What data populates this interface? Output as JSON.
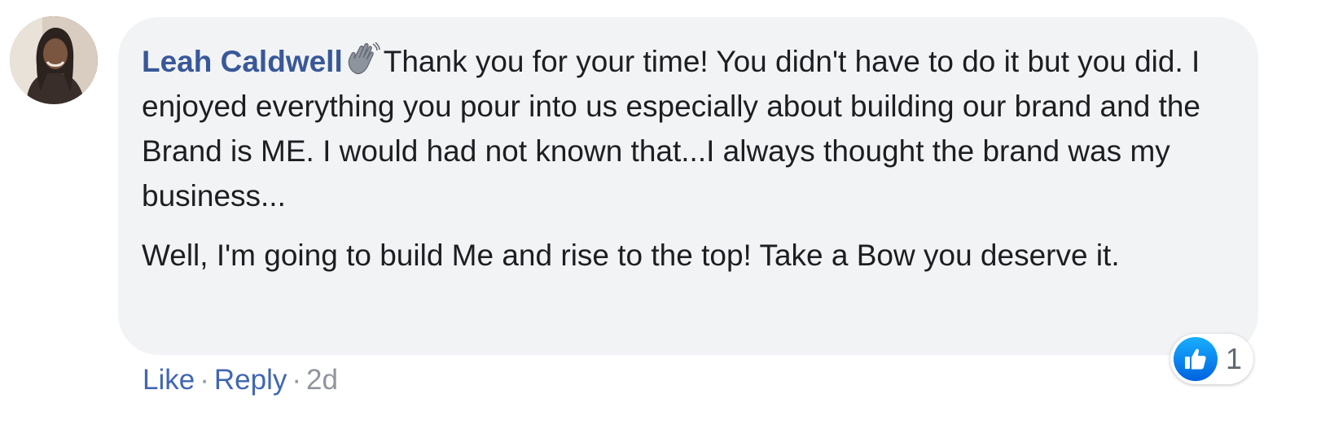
{
  "comment": {
    "author": "Leah Caldwell",
    "author_icon": "waving-hand-icon",
    "paragraph1": "Thank you for your time! You didn't have to do it but you did. I enjoyed everything you pour into us especially about building our brand and the Brand is ME. I would had not known that...I always thought the brand was my business...",
    "paragraph2": "Well, I'm going to build Me and rise to the top! Take a Bow you deserve it.",
    "actions": {
      "like_label": "Like",
      "reply_label": "Reply",
      "separator": "·",
      "timestamp": "2d"
    },
    "reactions": {
      "icon": "thumbs-up-icon",
      "count": "1"
    }
  },
  "colors": {
    "author": "#385898",
    "link": "#4267b2",
    "bubble": "#f2f3f5",
    "like_blue": "#0062df"
  }
}
